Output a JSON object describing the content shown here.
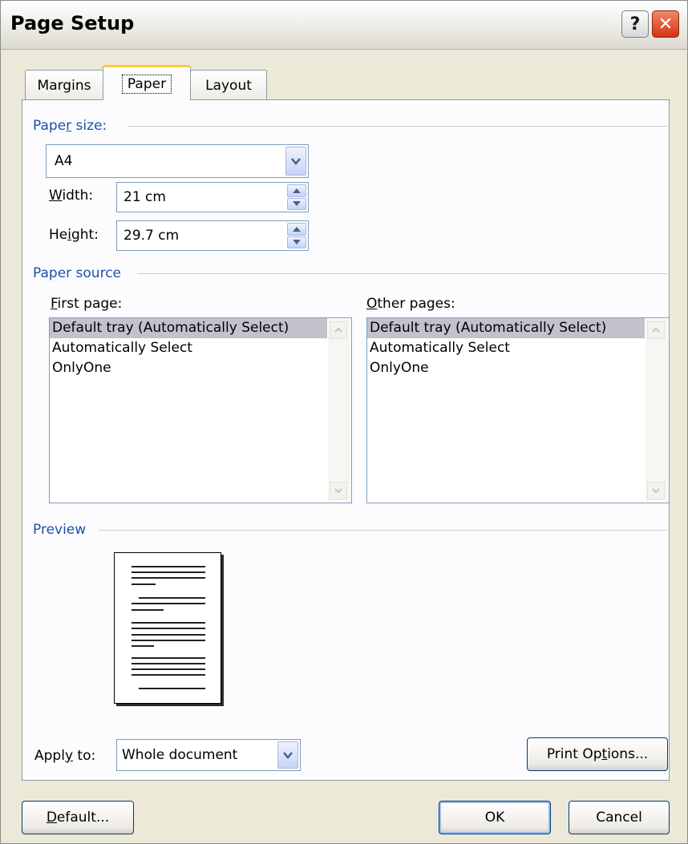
{
  "window": {
    "title": "Page Setup",
    "help_label": "?",
    "close_label": "✕"
  },
  "tabs": [
    {
      "label": "Margins"
    },
    {
      "label": "Paper",
      "active": true
    },
    {
      "label": "Layout"
    }
  ],
  "paper_size": {
    "group_label_a": "Pape",
    "group_label_u": "r",
    "group_label_b": " size:",
    "selected": "A4",
    "width": {
      "label_u": "W",
      "label_rest": "idth:",
      "value": "21 cm"
    },
    "height": {
      "label_a": "He",
      "label_u": "i",
      "label_rest": "ght:",
      "value": "29.7 cm"
    }
  },
  "paper_source": {
    "group_label": "Paper source",
    "first_page": {
      "label_u": "F",
      "label_rest": "irst page:",
      "items": [
        "Default tray (Automatically Select)",
        "Automatically Select",
        "OnlyOne"
      ],
      "selected_index": 0
    },
    "other_pages": {
      "label_u": "O",
      "label_rest": "ther pages:",
      "items": [
        "Default tray (Automatically Select)",
        "Automatically Select",
        "OnlyOne"
      ],
      "selected_index": 0
    }
  },
  "preview": {
    "group_label": "Preview"
  },
  "apply_to": {
    "label_a": "Appl",
    "label_u": "y",
    "label_rest": " to:",
    "value": "Whole document"
  },
  "buttons": {
    "print_options_a": "Print Op",
    "print_options_u": "t",
    "print_options_b": "ions...",
    "default_u": "D",
    "default_rest": "efault...",
    "ok": "OK",
    "cancel": "Cancel"
  },
  "colors": {
    "group_label": "#1f4fa8",
    "dialog_bg": "#ece9d8",
    "tab_active_highlight": "#ffc83c",
    "list_selection": "#c2c2cc"
  }
}
